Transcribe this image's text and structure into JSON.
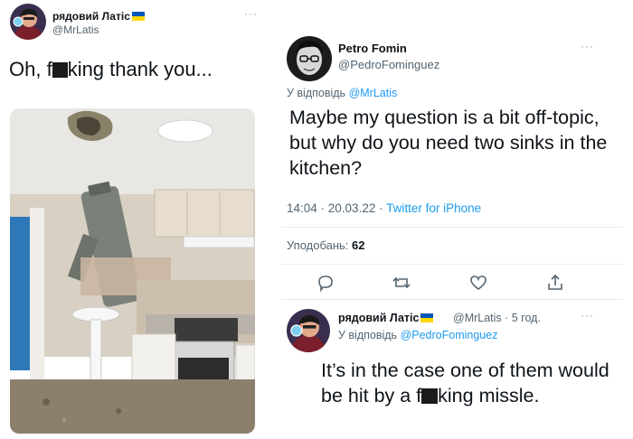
{
  "left_tweet": {
    "author_name": "рядовий Латіс",
    "author_handle": "@MrLatis",
    "text_before": "Oh, f",
    "text_after": "king thank you...",
    "more_icon": "more-dots-icon",
    "photo_alt": "kitchen-photo"
  },
  "main_reply": {
    "author_name": "Petro Fomin",
    "author_handle": "@PedroFominguez",
    "reply_prefix": "У відповідь",
    "reply_mention": "@MrLatis",
    "text": "Maybe my question is a bit off-topic, but why do you need two sinks in the kitchen?",
    "time": "14:04 · 20.03.22 · ",
    "source": "Twitter for iPhone",
    "likes_label": "Уподобань:",
    "likes_count": "62",
    "actions": [
      "reply-icon",
      "retweet-icon",
      "like-icon",
      "share-icon"
    ]
  },
  "second_reply": {
    "author_name": "рядовий Латіс",
    "author_handle": "@MrLatis",
    "time_ago": "· 5 год.",
    "reply_prefix": "У відповідь",
    "reply_mention": "@PedroFominguez",
    "text_before": "It’s in the case one of them would be hit by a f",
    "text_after": "king missle."
  },
  "colors": {
    "accent": "#1d9bf0",
    "secondary_text": "#536471",
    "flag_blue": "#0057b7",
    "flag_yellow": "#ffd700"
  }
}
